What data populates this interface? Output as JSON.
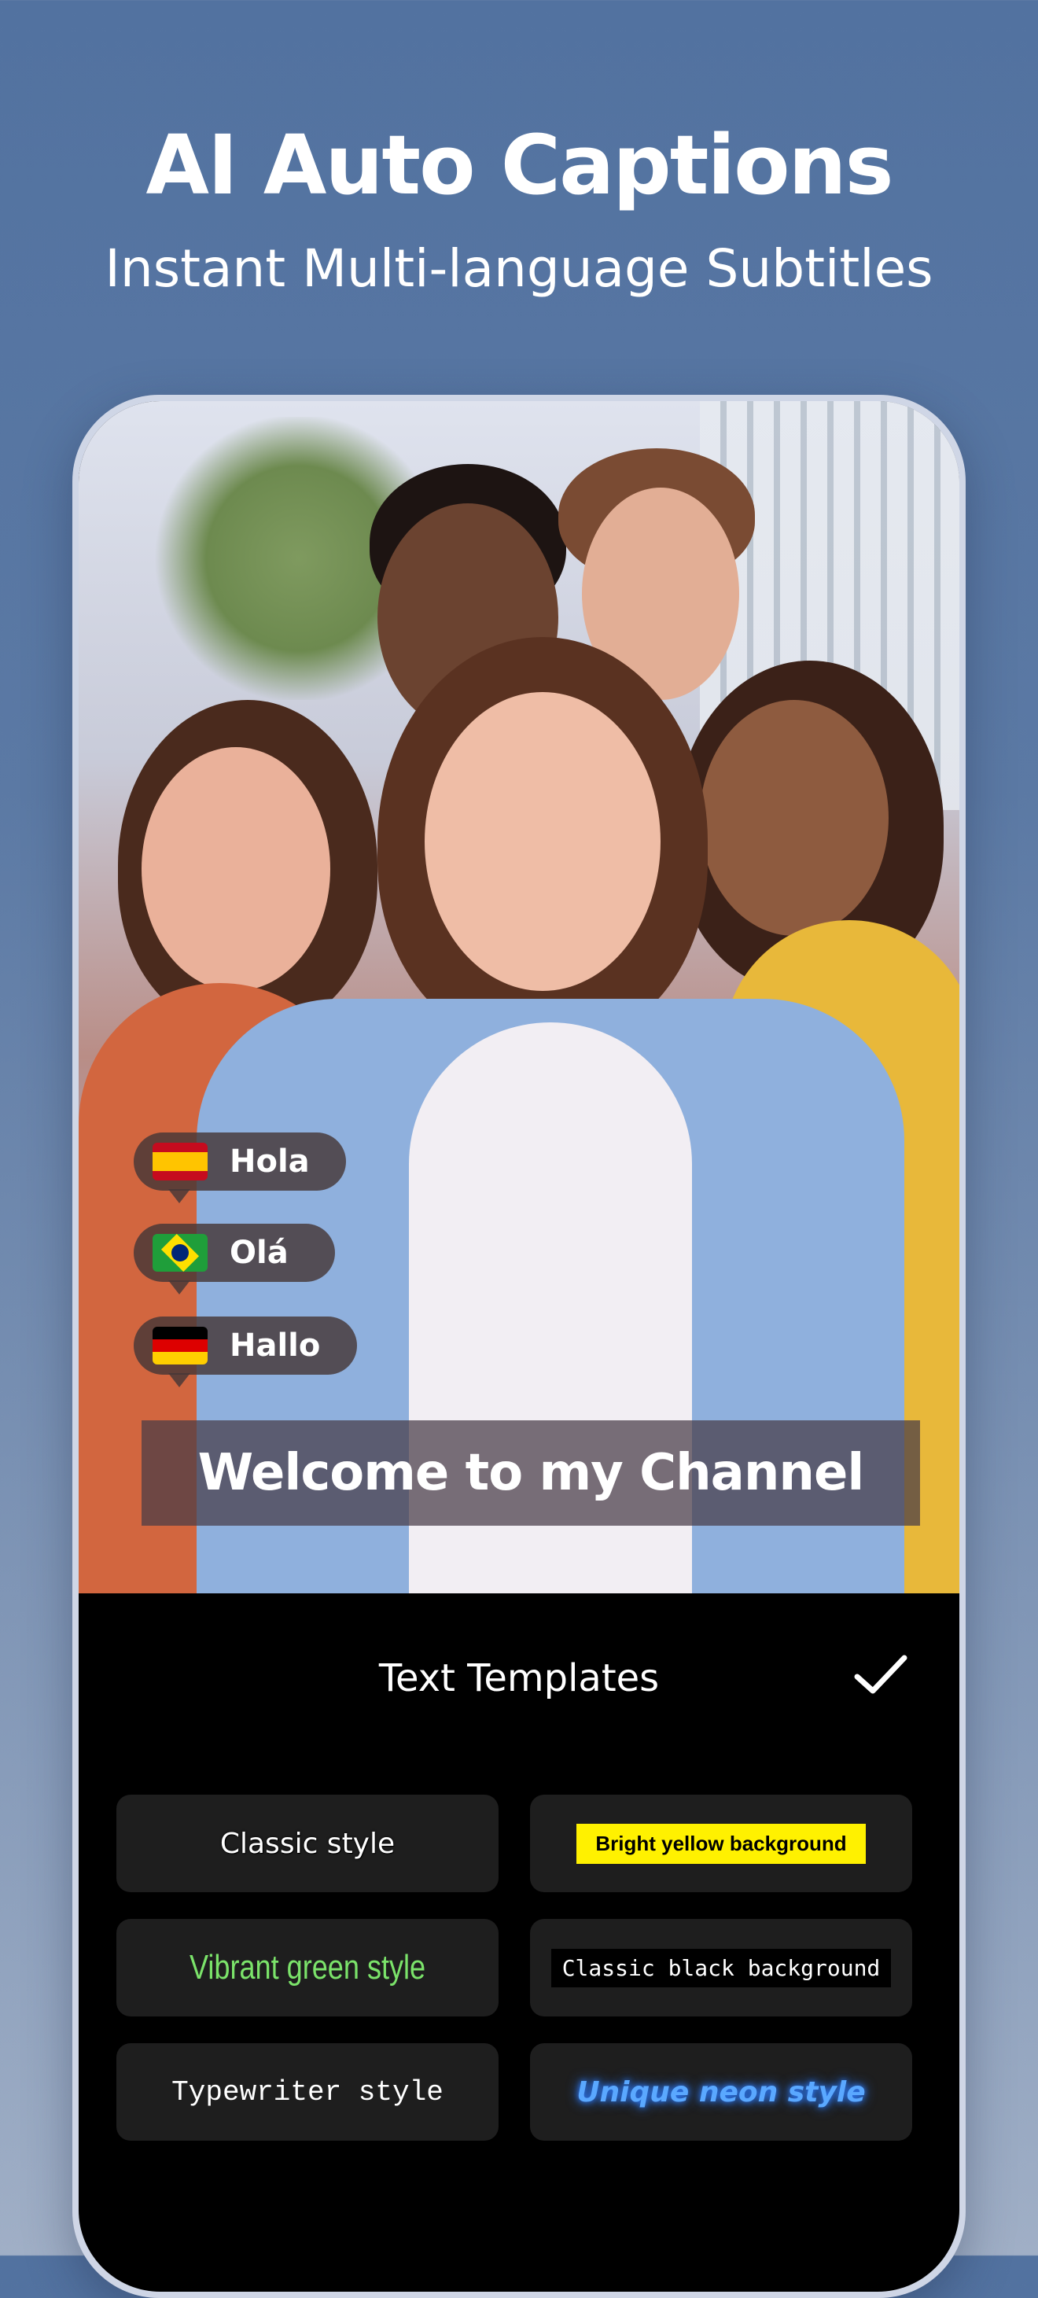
{
  "header": {
    "title": "AI Auto Captions",
    "subtitle": "Instant Multi-language Subtitles"
  },
  "preview": {
    "language_bubbles": [
      {
        "flag": "spain-flag-icon",
        "label": "Hola"
      },
      {
        "flag": "brazil-flag-icon",
        "label": "Olá"
      },
      {
        "flag": "germany-flag-icon",
        "label": "Hallo"
      }
    ],
    "caption": "Welcome to my Channel"
  },
  "panel": {
    "title": "Text Templates",
    "confirm_icon": "checkmark-icon",
    "templates": [
      {
        "label": "Classic style"
      },
      {
        "label": "Bright yellow background",
        "color": "#fff100"
      },
      {
        "label": "Vibrant green style",
        "color": "#7be36a"
      },
      {
        "label": "Classic black background"
      },
      {
        "label": "Typewriter style"
      },
      {
        "label": "Unique neon style",
        "color": "#5aa8ff"
      }
    ]
  },
  "colors": {
    "background_top": "#5272a0",
    "panel_bg": "#000000",
    "tile_bg": "#1e1e1e"
  }
}
